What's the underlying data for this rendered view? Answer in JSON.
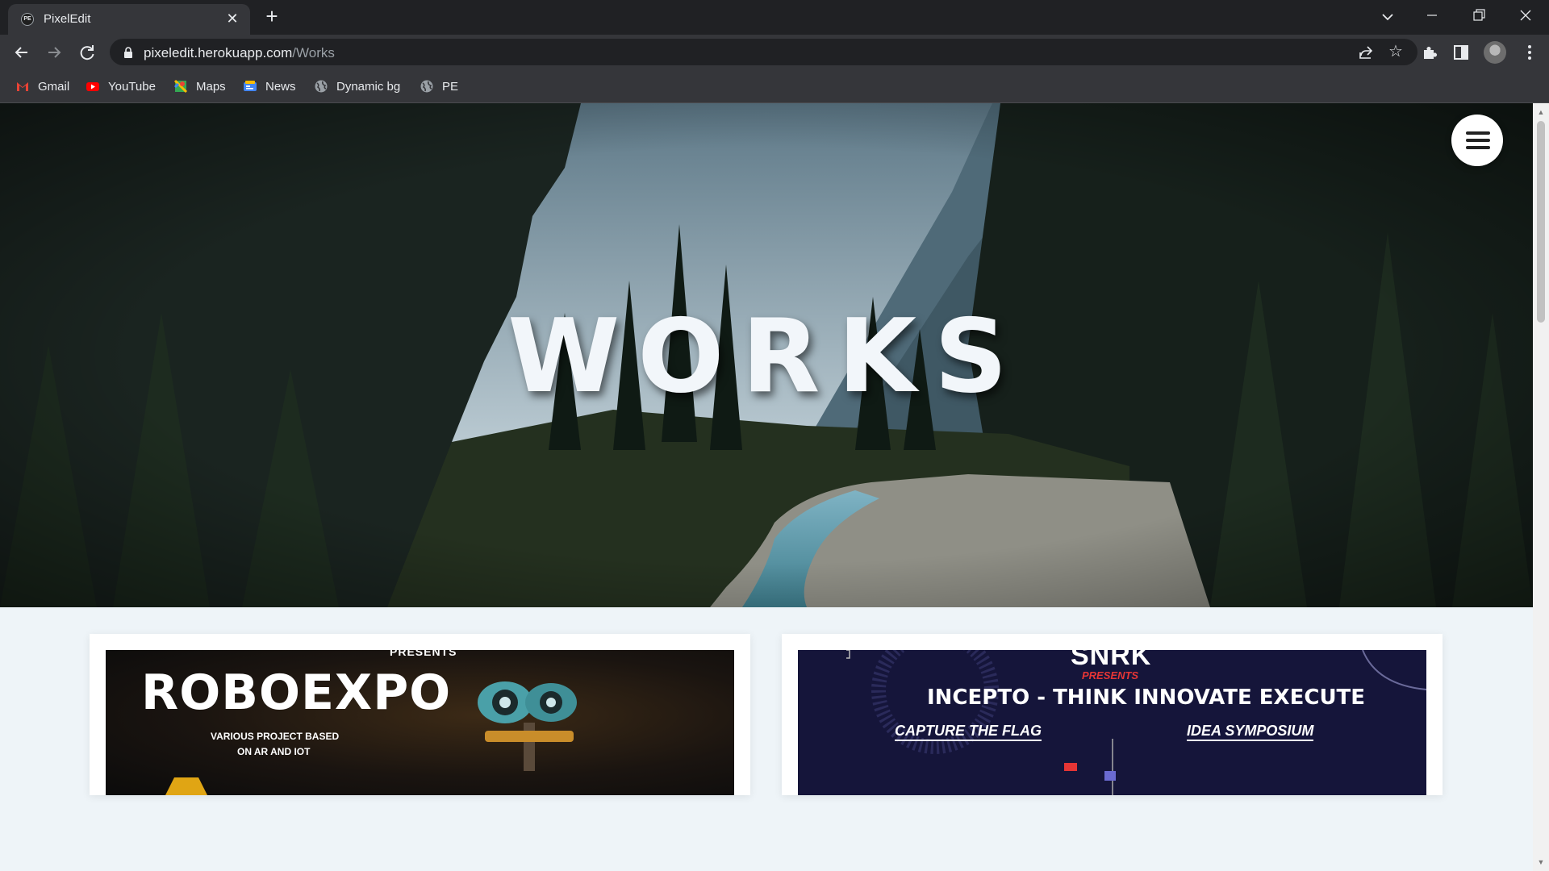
{
  "browser": {
    "tab_title": "PixelEdit",
    "tab_favicon_text": "PE",
    "new_tab_label": "+",
    "url_host": "pixeledit.herokuapp.com",
    "url_path": "/Works",
    "bookmarks": [
      {
        "label": "Gmail",
        "icon": "gmail-icon",
        "color": "#ea4335"
      },
      {
        "label": "YouTube",
        "icon": "youtube-icon",
        "color": "#ff0000"
      },
      {
        "label": "Maps",
        "icon": "maps-icon",
        "color": "#34a853"
      },
      {
        "label": "News",
        "icon": "news-icon",
        "color": "#4285f4"
      },
      {
        "label": "Dynamic bg",
        "icon": "globe-icon",
        "color": "#9aa0a6"
      },
      {
        "label": "PE",
        "icon": "globe-icon",
        "color": "#9aa0a6"
      }
    ]
  },
  "page": {
    "hero_title": "WORKS",
    "menu_icon": "hamburger-menu-icon",
    "cards": [
      {
        "presents": "PRESENTS",
        "title": "ROBOEXPO",
        "subtitle_line1": "VARIOUS PROJECT BASED",
        "subtitle_line2": "ON AR AND IOT"
      },
      {
        "logo": "SNRK",
        "presents": "PRESENTS",
        "title": "INCEPTO - THINK INNOVATE EXECUTE",
        "event1": "CAPTURE THE FLAG",
        "event2": "IDEA SYMPOSIUM"
      }
    ]
  },
  "colors": {
    "chrome_dark": "#202124",
    "chrome_toolbar": "#35363a",
    "page_bg": "#eef4f8",
    "hero_text": "#f2f6fa",
    "accent_red": "#e02a2a"
  }
}
